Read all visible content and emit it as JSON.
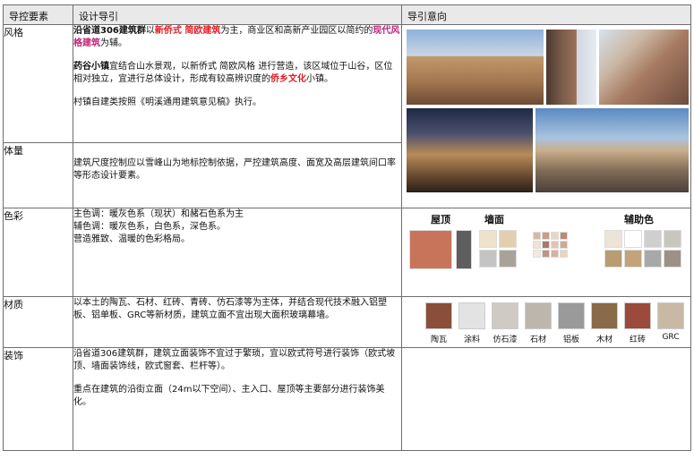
{
  "headers": {
    "factor": "导控要素",
    "guide": "设计导引",
    "intent": "导引意向"
  },
  "rows": {
    "style": {
      "factor": "风格",
      "para1": {
        "a": "沿省道306建筑群",
        "b": "以",
        "c": "新侨式 简欧建筑",
        "d": "为主，商业区和高新产业园区以简约的",
        "e": "现代风格建筑",
        "f": "为辅。"
      },
      "para2": {
        "a": "药谷小镇",
        "b": "宜结合山水景观，以新侨式 简欧风格 进行营造，该区域位于山谷，区位相对独立，宜进行总体设计，形成有较高辨识度的",
        "c": "侨乡文化",
        "d": "小镇。"
      },
      "para3": "村镇自建类按照《明溪通用建筑意见稿》执行。"
    },
    "volume": {
      "factor": "体量",
      "text": "建筑尺度控制应以雪峰山为地标控制依据，严控建筑高度、面宽及高层建筑间口率等形态设计要素。"
    },
    "color": {
      "factor": "色彩",
      "line1": "主色调：暖灰色系（现状）和赭石色系为主",
      "line2": "辅色调：暖灰色系，白色系，深色系。",
      "line3": "营造雅致、温暖的色彩格局。",
      "labels": {
        "roof": "屋顶",
        "wall": "墙面",
        "aux": "辅助色"
      },
      "colors": {
        "roof": [
          "#c8745a",
          "#5e5e5e"
        ],
        "wall": [
          "#efe2cb",
          "#e2cfb0",
          "#c4c4c4",
          "#a8a29a"
        ],
        "mosaic": [
          "#d9b7a3",
          "#c99c84",
          "#e8d6c8",
          "#b98b74",
          "#f0e3d8",
          "#a8796a",
          "#e3c4b1",
          "#cfa892",
          "#f4e9de",
          "#bc9584",
          "#d7b29e",
          "#e9d3c3"
        ],
        "aux": [
          "#ede3d6",
          "#ffffff",
          "#cfcfcf",
          "#c9c6bf",
          "#b89c72",
          "#c4a27a",
          "#a8a8a8",
          "#9b9186"
        ]
      }
    },
    "material": {
      "factor": "材质",
      "text": "以本土的陶瓦、石材、红砖、青砖、仿石漆等为主体，并结合现代技术融入铝塑板、铝单板、GRC等新材质，建筑立面不宜出现大面积玻璃幕墙。",
      "items": [
        {
          "label": "陶瓦",
          "color": "#8a4e3a"
        },
        {
          "label": "涂料",
          "color": "#e3e3e3"
        },
        {
          "label": "仿石漆",
          "color": "#cfcac3"
        },
        {
          "label": "石材",
          "color": "#bcb6ad"
        },
        {
          "label": "铝板",
          "color": "#9a9a9a"
        },
        {
          "label": "木材",
          "color": "#8a6a48"
        },
        {
          "label": "红砖",
          "color": "#9b4a3c"
        },
        {
          "label": "GRC",
          "color": "#c7b9a3"
        }
      ]
    },
    "decor": {
      "factor": "装饰",
      "para1": "沿省道306建筑群，建筑立面装饰不宜过于繁琐，宜以欧式符号进行装饰（欧式坡顶、墙面装饰线，欧式窗套、栏杆等）。",
      "para2": "重点在建筑的沿街立面（24m以下空间）、主入口、屋顶等主要部分进行装饰美化。"
    }
  }
}
